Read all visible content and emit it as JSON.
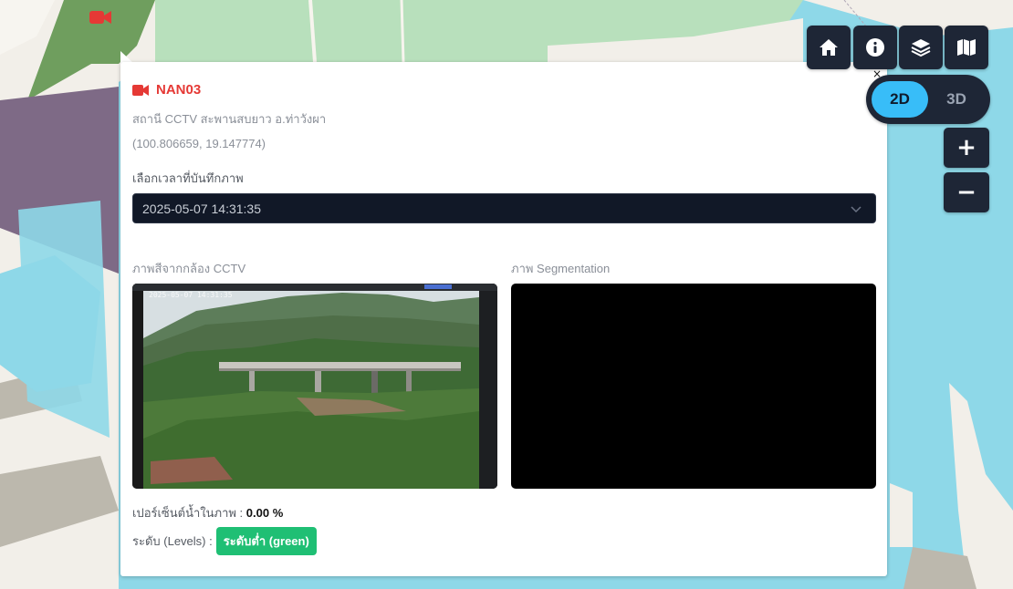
{
  "map": {
    "marker_icon": "video-camera-icon",
    "marker_color": "#e53935"
  },
  "popup": {
    "close_label": "×",
    "station_code": "NAN03",
    "station_name": "สถานี CCTV สะพานสบยาว อ.ท่าวังผา",
    "coordinates": "(100.806659, 19.147774)",
    "time_label": "เลือกเวลาที่บันทึกภาพ",
    "time_selected": "2025-05-07 14:31:35",
    "cctv_label": "ภาพสีจากกล้อง CCTV",
    "segmentation_label": "ภาพ Segmentation",
    "water_percent_label": "เปอร์เซ็นต์น้ำในภาพ :",
    "water_percent_value": "0.00 %",
    "level_label": "ระดับ (Levels) :",
    "level_value": "ระดับต่ำ (green)",
    "level_color": "#1fbf74"
  },
  "toolbar": {
    "buttons": [
      {
        "name": "home",
        "icon": "home-icon"
      },
      {
        "name": "info",
        "icon": "info-icon"
      },
      {
        "name": "layers",
        "icon": "layers-icon"
      },
      {
        "name": "basemap",
        "icon": "map-icon"
      }
    ],
    "dimension_options": [
      "2D",
      "3D"
    ],
    "dimension_active": "2D",
    "zoom_in_label": "+",
    "zoom_out_label": "−"
  }
}
